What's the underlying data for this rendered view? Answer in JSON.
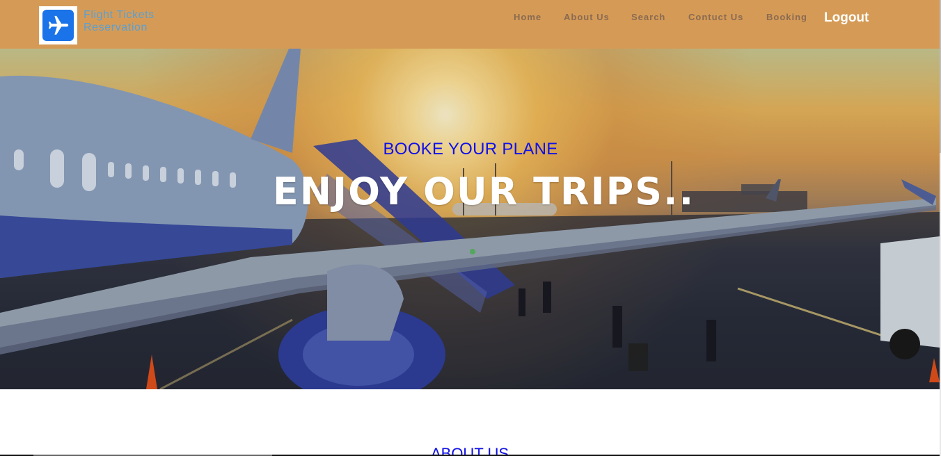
{
  "brand": {
    "line1": "Flight Tickets",
    "line2": "Reservation",
    "logo_icon": "airplane-icon"
  },
  "nav": {
    "home": "Home",
    "about": "About Us",
    "search": "Search",
    "contact": "Contuct Us",
    "booking": "Booking",
    "logout": "Logout"
  },
  "hero": {
    "subtitle": "BOOKE YOUR PLANE",
    "title": "ENJOY OUR TRIPS.."
  },
  "about": {
    "title": "ABOUT US"
  },
  "colors": {
    "header_bg": "#d59b56",
    "nav_text": "#8a6a52",
    "accent_blue": "#1010e8",
    "logo_blue": "#1a73e8"
  }
}
